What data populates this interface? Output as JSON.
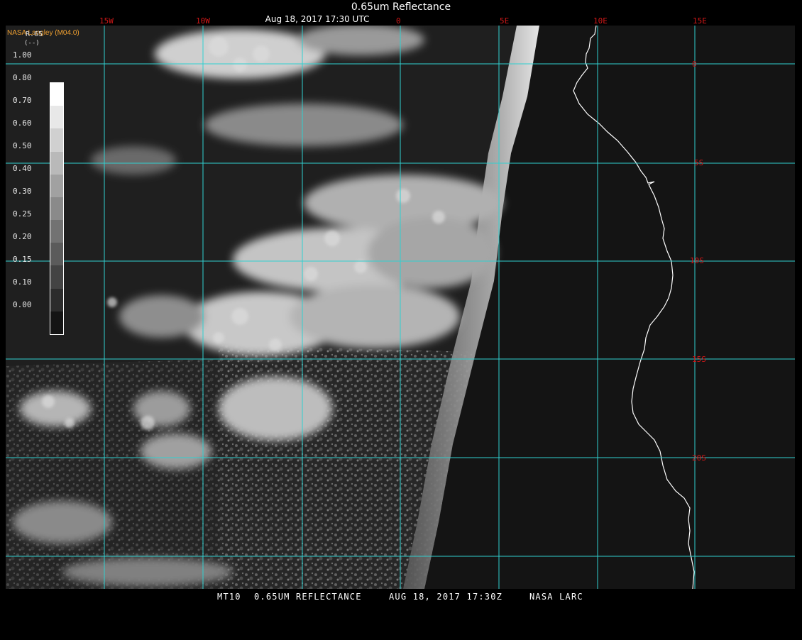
{
  "header": {
    "title": "0.65um Reflectance",
    "subtitle": "Aug 18, 2017 17:30 UTC"
  },
  "producer": "NASA Langley (M04.0)",
  "legend": {
    "variable": "R.65",
    "unit": "(--)",
    "ticks": [
      "1.00",
      "0.80",
      "0.70",
      "0.60",
      "0.50",
      "0.40",
      "0.30",
      "0.25",
      "0.20",
      "0.15",
      "0.10",
      "0.00"
    ]
  },
  "grid": {
    "lon_labels": [
      "15W",
      "10W",
      "0",
      "5E",
      "10E",
      "15E"
    ],
    "lat_labels": [
      "0",
      "5S",
      "10S",
      "15S",
      "20S"
    ],
    "line_color": "#30d0d0",
    "label_color": "#d01818"
  },
  "footer": {
    "satellite": "MT10",
    "product": "0.65UM REFLECTANCE",
    "datetime": "AUG 18, 2017 17:30Z",
    "agency": "NASA LARC"
  },
  "colors": {
    "background": "#000000",
    "coastline": "#ffffff",
    "land": "#151515",
    "ocean": "#1e1e1e"
  }
}
